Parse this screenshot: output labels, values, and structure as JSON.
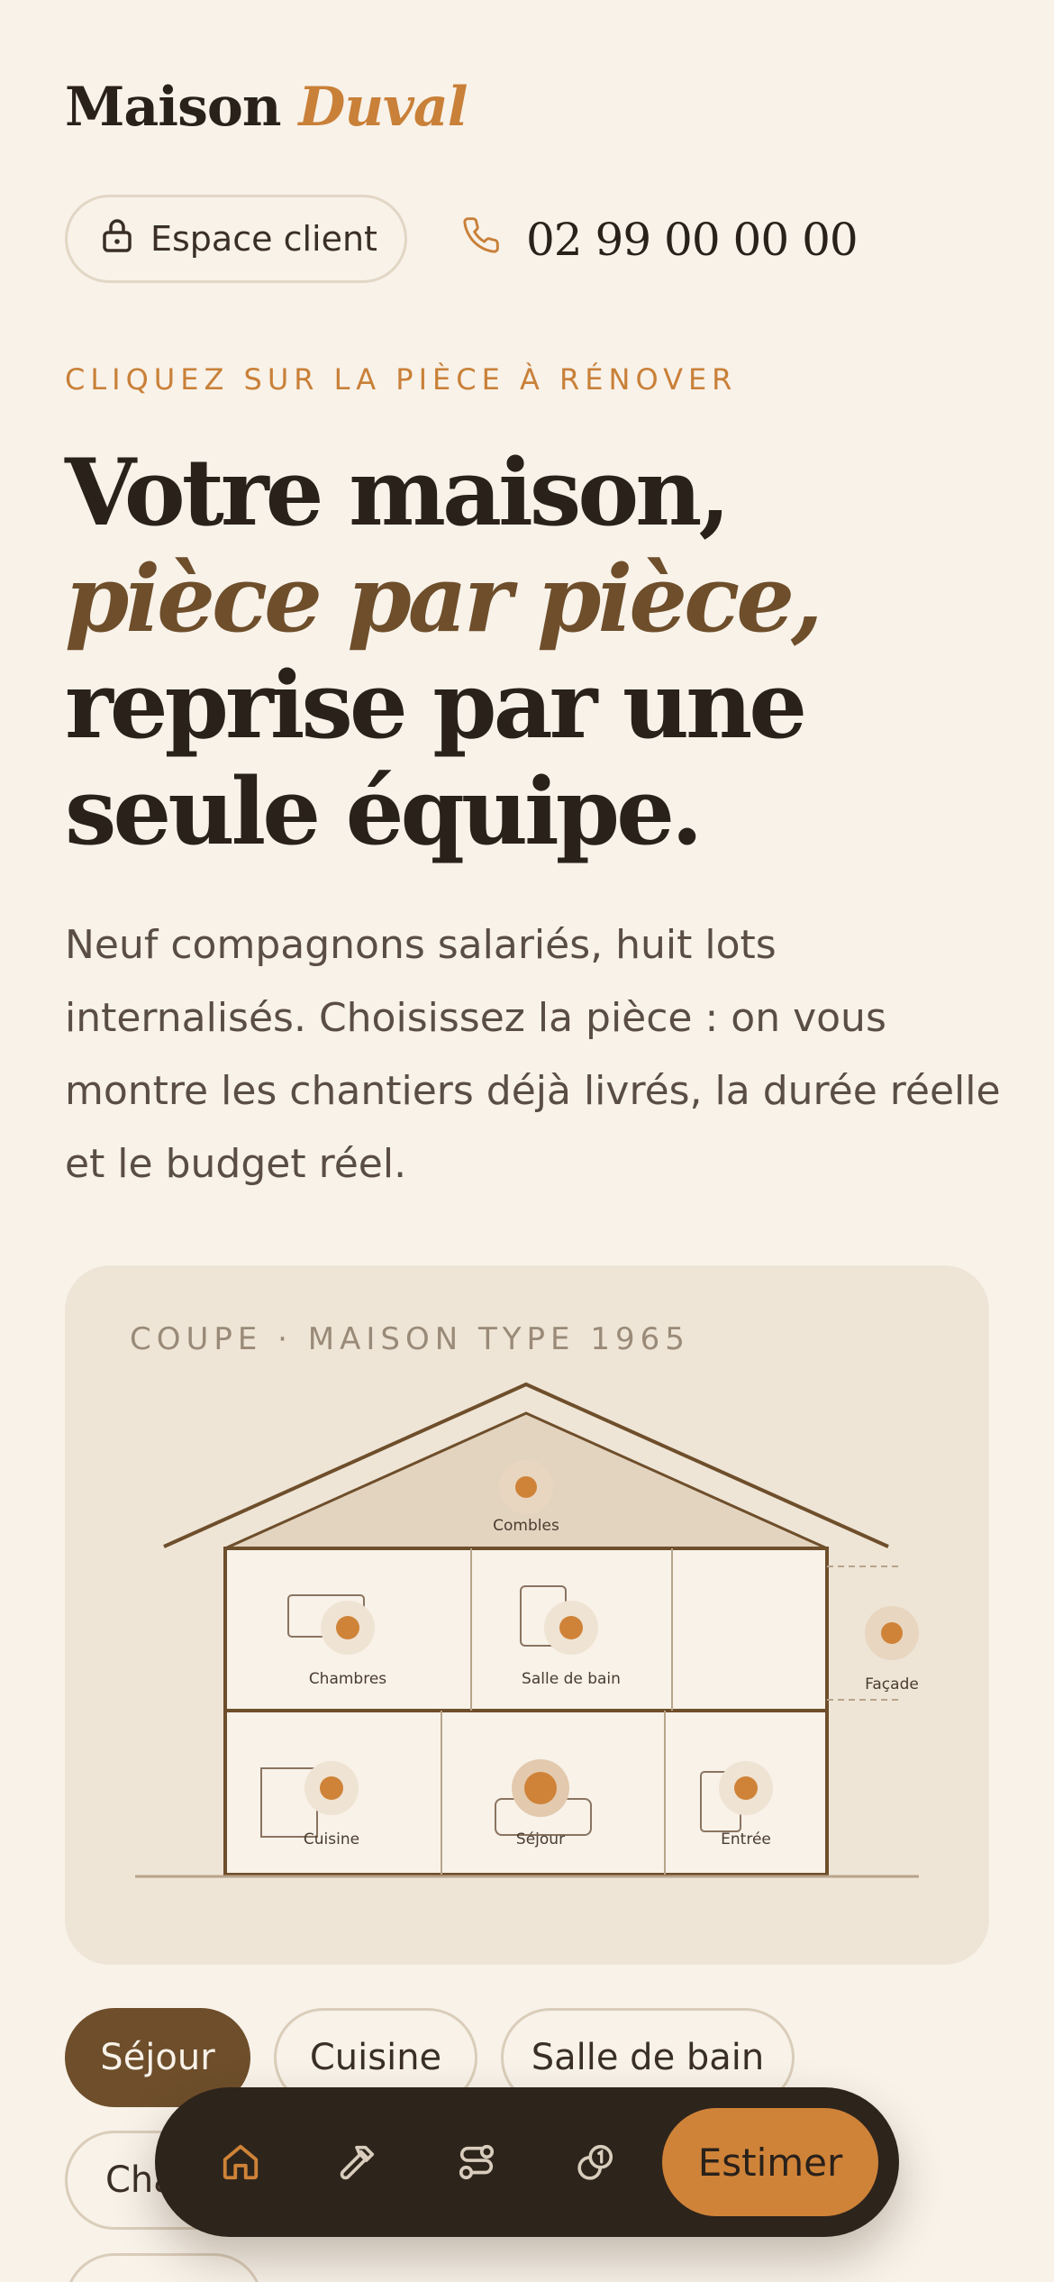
{
  "brand": {
    "name": "Maison",
    "accent": "Duval"
  },
  "header": {
    "client_label": "Espace client",
    "phone": "02 99 00 00 00"
  },
  "hero": {
    "kicker": "CLIQUEZ SUR LA PIÈCE À RÉNOVER",
    "headline_start": "Votre maison, ",
    "headline_accent": "pièce par pièce,",
    "headline_end": "reprise par une seule équipe.",
    "intro": "Neuf compagnons salariés, huit lots internalisés. Choisissez la pièce : on vous montre les chantiers déjà livrés, la durée réelle et le budget réel."
  },
  "plan": {
    "title": "COUPE · MAISON TYPE 1965",
    "rooms": {
      "combles": "Combles",
      "chambres": "Chambres",
      "salle_de_bain": "Salle de bain",
      "facade": "Façade",
      "cuisine": "Cuisine",
      "sejour": "Séjour",
      "entree": "Entrée"
    },
    "selected": "Séjour"
  },
  "chips": [
    {
      "label": "Séjour",
      "active": true
    },
    {
      "label": "Cuisine",
      "active": false
    },
    {
      "label": "Salle de bain",
      "active": false
    },
    {
      "label": "Chambres",
      "active": false
    }
  ],
  "bottom_nav": {
    "items": [
      "home-icon",
      "hammer-icon",
      "route-icon",
      "coins-icon"
    ],
    "cta": "Estimer"
  },
  "colors": {
    "background": "#f8f2e9",
    "accent": "#c98038",
    "brown": "#6e4e2b",
    "dark": "#2d241c"
  }
}
